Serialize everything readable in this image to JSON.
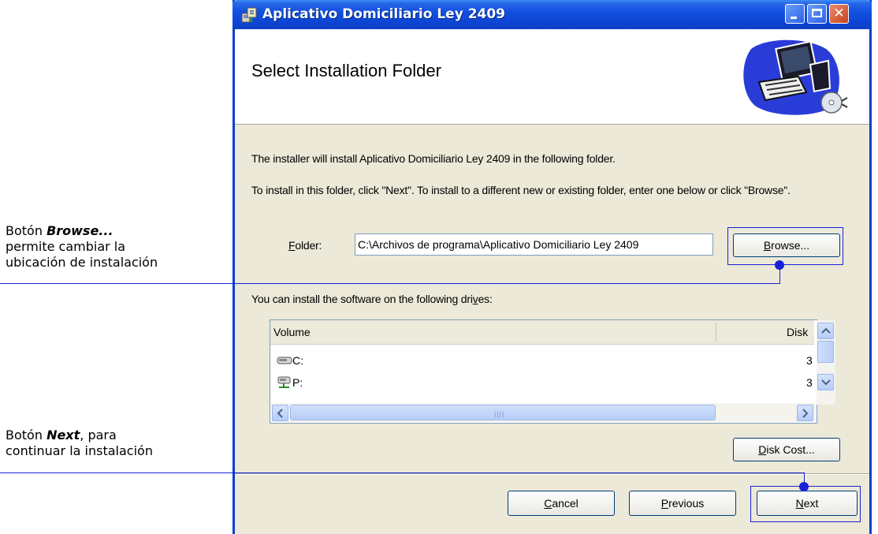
{
  "window": {
    "title": "Aplicativo Domiciliario Ley 2409",
    "banner_title": "Select Installation Folder"
  },
  "body": {
    "intro": "The installer will install Aplicativo Domiciliario Ley 2409 in the following folder.",
    "instruction": "To install in this folder, click \"Next\". To install to a different new or existing folder, enter one below or click \"Browse\".",
    "folder_label_access": "F",
    "folder_label_rest": "older:",
    "folder_value": "C:\\Archivos de programa\\Aplicativo Domiciliario Ley 2409",
    "browse_access": "B",
    "browse_rest": "rowse...",
    "drives_pre": "You can install the software on the following dri",
    "drives_access": "v",
    "drives_post": "es:"
  },
  "drives_list": {
    "columns": [
      "Volume",
      "Disk"
    ],
    "rows": [
      {
        "name": "C:",
        "disk": "3",
        "icon": "hard-drive-icon"
      },
      {
        "name": "P:",
        "disk": "3",
        "icon": "network-drive-icon"
      }
    ]
  },
  "buttons": {
    "disk_cost_access": "D",
    "disk_cost_rest": "isk Cost...",
    "cancel_access": "C",
    "cancel_rest": "ancel",
    "previous_access": "P",
    "previous_rest": "revious",
    "next_access": "N",
    "next_rest": "ext"
  },
  "annotations": {
    "browse": {
      "prefix": "Botón ",
      "keyword": "Browse...",
      "line2": "permite cambiar la",
      "line3": "ubicación de instalación"
    },
    "next": {
      "prefix": "Botón ",
      "keyword": "Next",
      "suffix": ", para",
      "line2": "continuar la instalación"
    }
  },
  "colors": {
    "callout": "#1a22d8",
    "titlebar": "#0d47d6",
    "dialog_bg": "#ece9d8"
  }
}
